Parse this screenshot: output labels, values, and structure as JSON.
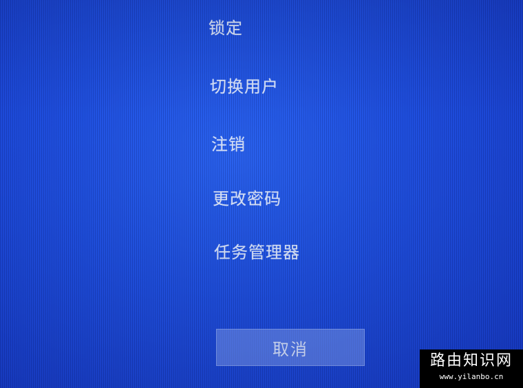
{
  "security_screen": {
    "options": [
      {
        "id": "lock",
        "label": "锁定"
      },
      {
        "id": "switch-user",
        "label": "切换用户"
      },
      {
        "id": "sign-out",
        "label": "注销"
      },
      {
        "id": "change-password",
        "label": "更改密码"
      },
      {
        "id": "task-manager",
        "label": "任务管理器"
      }
    ],
    "cancel_label": "取消"
  },
  "watermark": {
    "title": "路由知识网",
    "url": "www.yilanbo.cn"
  },
  "colors": {
    "background": "#1f4fe0",
    "text": "#d6e0f6",
    "button": "#7896eb"
  }
}
